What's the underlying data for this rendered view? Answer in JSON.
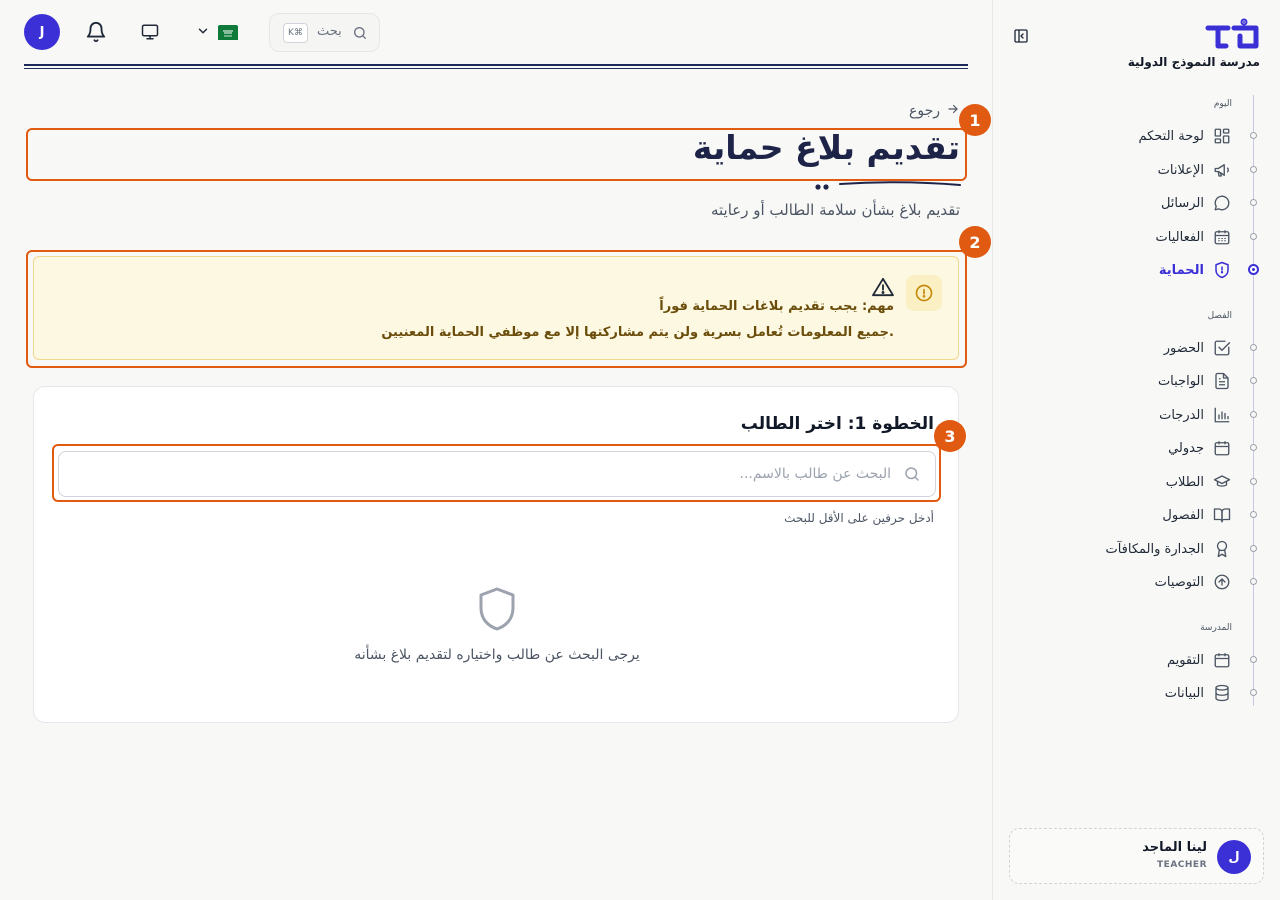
{
  "sidebar": {
    "school_name": "مدرسة النموذج الدولية",
    "sections": [
      {
        "label": "اليوم"
      },
      {
        "label": "الفصل"
      },
      {
        "label": "المدرسة"
      }
    ],
    "items": [
      {
        "label": "لوحة التحكم",
        "icon": "dashboard-icon"
      },
      {
        "label": "الإعلانات",
        "icon": "megaphone-icon"
      },
      {
        "label": "الرسائل",
        "icon": "message-icon"
      },
      {
        "label": "الفعاليات",
        "icon": "calendar-grid-icon"
      },
      {
        "label": "الحماية",
        "icon": "shield-icon",
        "active": true
      },
      {
        "label": "الحضور",
        "icon": "check-square-icon"
      },
      {
        "label": "الواجبات",
        "icon": "file-text-icon"
      },
      {
        "label": "الدرجات",
        "icon": "bar-chart-icon"
      },
      {
        "label": "جدولي",
        "icon": "calendar-icon"
      },
      {
        "label": "الطلاب",
        "icon": "graduation-cap-icon"
      },
      {
        "label": "الفصول",
        "icon": "book-open-icon"
      },
      {
        "label": "الجدارة والمكافآت",
        "icon": "award-icon"
      },
      {
        "label": "التوصيات",
        "icon": "arrow-up-circle-icon"
      },
      {
        "label": "التقويم",
        "icon": "calendar-icon"
      },
      {
        "label": "البيانات",
        "icon": "database-icon"
      }
    ],
    "user": {
      "initial": "ل",
      "name": "لينا الماجد",
      "role": "TEACHER"
    }
  },
  "topbar": {
    "avatar_initial": "J",
    "search_label": "بحث",
    "shortcut": "K⌘"
  },
  "main": {
    "back_label": "رجوع",
    "title": "تقديم بلاغ حماية",
    "subtitle": "تقديم بلاغ بشأن سلامة الطالب أو رعايته",
    "alert": {
      "title": "مهم: يجب تقديم بلاغات الحماية فوراً",
      "text": "جميع المعلومات تُعامل بسرية ولن يتم مشاركتها إلا مع موظفي الحماية المعنيين."
    },
    "step": {
      "title": "الخطوة 1: اختر الطالب",
      "search_placeholder": "البحث عن طالب بالاسم...",
      "search_value": "",
      "hint": "أدخل حرفين على الأقل للبحث",
      "empty_text": "يرجى البحث عن طالب واختياره لتقديم بلاغ بشأنه"
    }
  },
  "annotations": {
    "markers": [
      "1",
      "2",
      "3"
    ],
    "color": "#e05a12"
  },
  "colors": {
    "accent": "#3b2fd6",
    "title": "#1e2448",
    "alert_bg": "#fdf8e1",
    "alert_text": "#6b4d0b"
  }
}
